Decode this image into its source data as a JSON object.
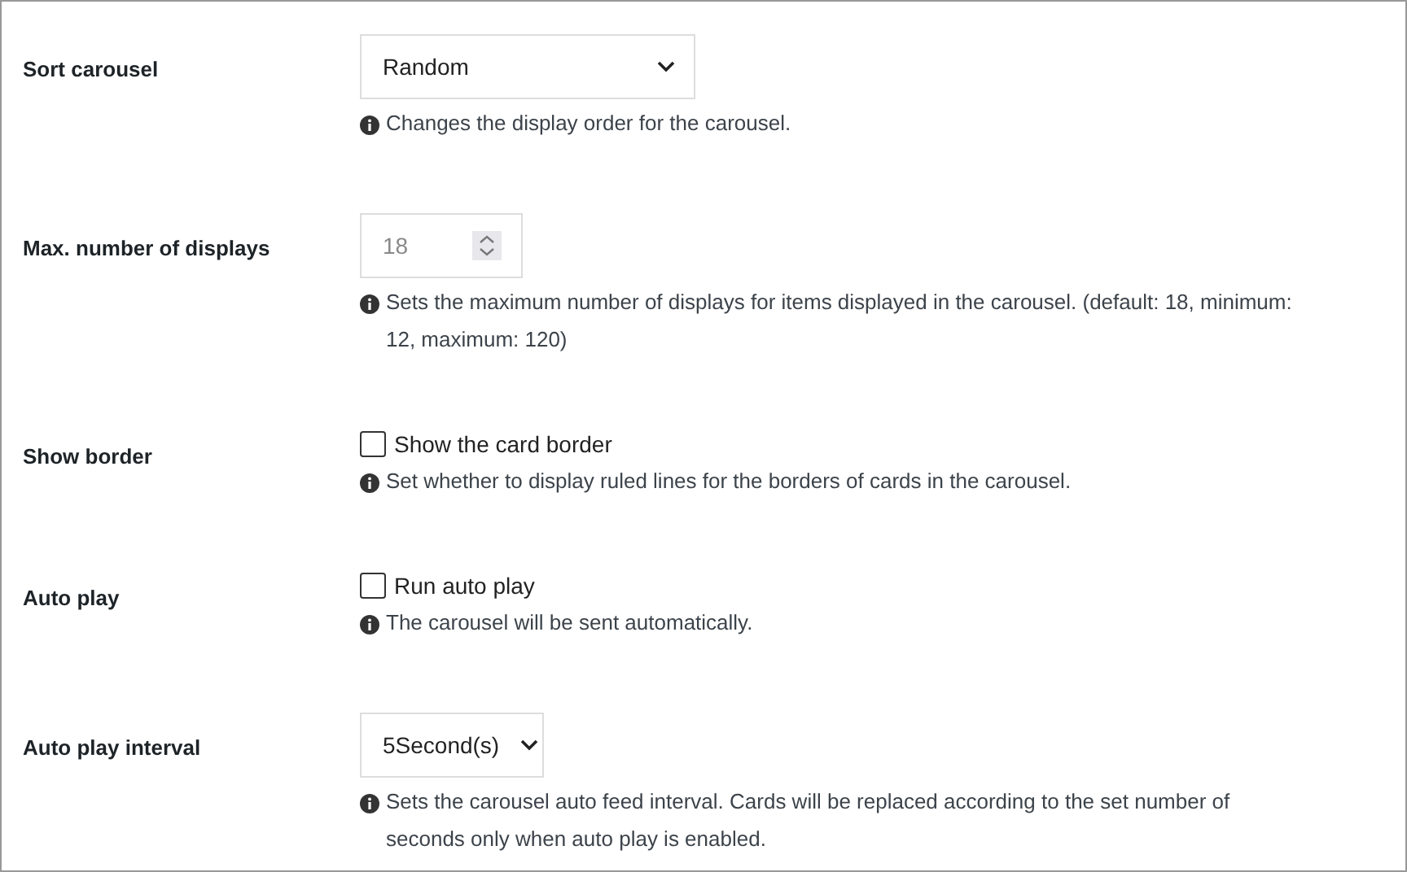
{
  "settings": [
    {
      "kind": "select",
      "label": "Sort carousel",
      "value": "Random",
      "help": "Changes the display order for the carousel."
    },
    {
      "kind": "number",
      "label": "Max. number of displays",
      "value": "18",
      "help": "Sets the maximum number of displays for items displayed in the carousel. (default: 18, minimum: 12, maximum: 120)"
    },
    {
      "kind": "checkbox",
      "label": "Show border",
      "option": "Show the card border",
      "checked": false,
      "help": "Set whether to display ruled lines for the borders of cards in the carousel."
    },
    {
      "kind": "checkbox",
      "label": "Auto play",
      "option": "Run auto play",
      "checked": false,
      "help": "The carousel will be sent automatically."
    },
    {
      "kind": "select",
      "label": "Auto play interval",
      "value": "5Second(s)",
      "help": "Sets the carousel auto feed interval. Cards will be replaced according to the set number of seconds only when auto play is enabled."
    }
  ]
}
